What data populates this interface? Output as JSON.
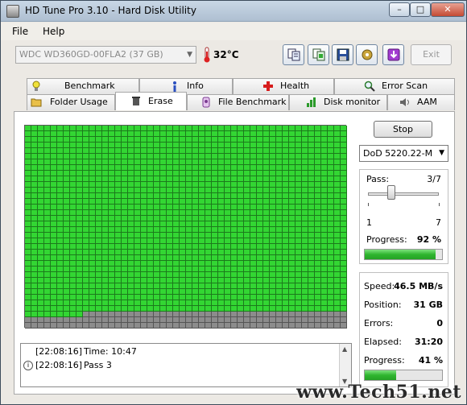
{
  "window": {
    "title": "HD Tune Pro 3.10 - Hard Disk Utility",
    "controls": {
      "minimize": "–",
      "maximize": "□",
      "close": "✕"
    }
  },
  "menu": {
    "file": "File",
    "help": "Help"
  },
  "toolbar": {
    "drive": "WDC WD360GD-00FLA2 (37 GB)",
    "temperature": "32°C",
    "exit_label": "Exit",
    "buttons": [
      "copy-text-icon",
      "copy-screenshot-icon",
      "save-icon",
      "options-icon",
      "save-to-disk-icon"
    ]
  },
  "tabs": {
    "row1": [
      "Benchmark",
      "Info",
      "Health",
      "Error Scan"
    ],
    "row2": [
      "Folder Usage",
      "Erase",
      "File Benchmark",
      "Disk monitor",
      "AAM"
    ],
    "active": "Erase"
  },
  "erase": {
    "stop_label": "Stop",
    "method": "DoD 5220.22-M",
    "pass": {
      "label": "Pass:",
      "value": "3/7",
      "min": "1",
      "max": "7",
      "slider_value": 3
    },
    "pass_progress": {
      "label": "Progress:",
      "value": "92 %",
      "fraction": 0.92
    },
    "stats": {
      "speed_label": "Speed:",
      "speed": "46.5 MB/s",
      "position_label": "Position:",
      "position": "31 GB",
      "errors_label": "Errors:",
      "errors": "0",
      "elapsed_label": "Elapsed:",
      "elapsed": "31:20",
      "progress_label": "Progress:",
      "progress": "41 %",
      "progress_fraction": 0.41
    },
    "map": {
      "columns": 50,
      "rows": 36,
      "completed_blocks": 1659
    }
  },
  "log": [
    {
      "time": "[22:08:16]",
      "message": "Time: 10:47",
      "icon": ""
    },
    {
      "time": "[22:08:16]",
      "message": "Pass 3",
      "icon": "info-icon"
    }
  ],
  "watermark": "www.Tech51.net",
  "colors": {
    "done": "#33d633",
    "pending": "#8c8c8c",
    "progress": "#2fb52f"
  }
}
